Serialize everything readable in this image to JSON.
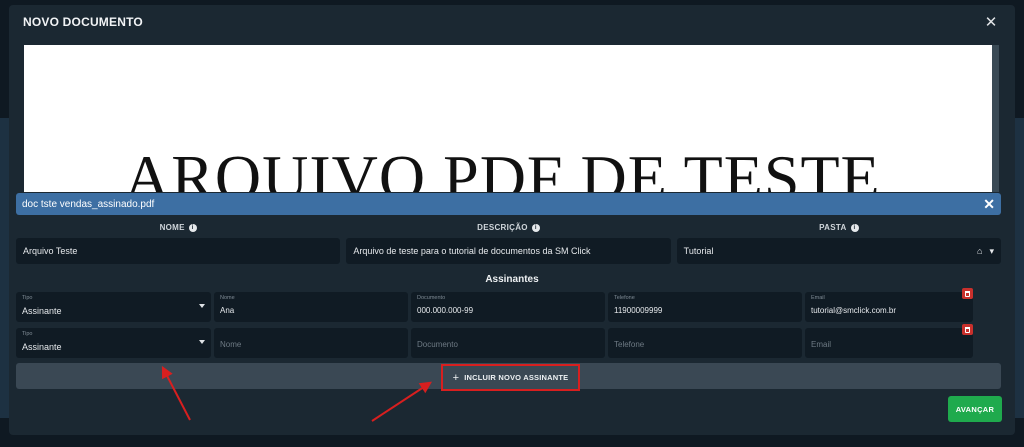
{
  "modal": {
    "title": "NOVO DOCUMENTO",
    "close_icon": "close-icon"
  },
  "preview": {
    "pdf_text": "ARQUIVO PDF DE TESTE"
  },
  "file": {
    "name": "doc tste vendas_assinado.pdf",
    "clear_icon": "close-icon"
  },
  "fields": {
    "nome": {
      "label": "NOME",
      "value": "Arquivo Teste"
    },
    "descricao": {
      "label": "DESCRIÇÃO",
      "value": "Arquivo de teste para o tutorial de documentos da SM Click"
    },
    "pasta": {
      "label": "PASTA",
      "value": "Tutorial"
    }
  },
  "signers": {
    "title": "Assinantes",
    "rows": [
      {
        "tipo_label": "Tipo",
        "tipo": "Assinante",
        "nome_label": "Nome",
        "nome": "Ana",
        "documento_label": "Documento",
        "documento": "000.000.000-99",
        "telefone_label": "Telefone",
        "telefone": "11900009999",
        "email_label": "Email",
        "email": "tutorial@smclick.com.br"
      },
      {
        "tipo_label": "Tipo",
        "tipo": "Assinante",
        "nome_placeholder": "Nome",
        "documento_placeholder": "Documento",
        "telefone_placeholder": "Telefone",
        "email_placeholder": "Email"
      }
    ],
    "add_label": "INCLUIR NOVO ASSINANTE"
  },
  "actions": {
    "next_label": "AVANÇAR"
  },
  "colors": {
    "accent_blue": "#3d6fa3",
    "danger": "#c9302c",
    "success": "#1faa4d",
    "highlight": "#d81f1f"
  }
}
